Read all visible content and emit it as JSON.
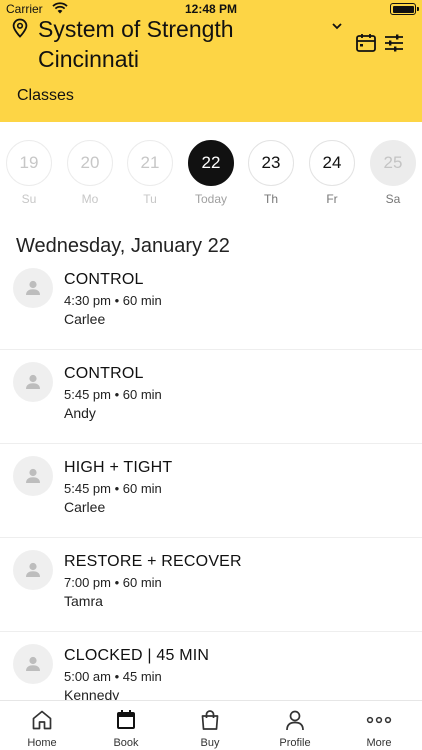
{
  "status_bar": {
    "carrier": "Carrier",
    "time": "12:48 PM"
  },
  "header": {
    "location_line1": "System of Strength",
    "location_line2": "Cincinnati",
    "section_label": "Classes",
    "background_color": "#fdd545"
  },
  "days": [
    {
      "number": "19",
      "label": "Su",
      "state": "past"
    },
    {
      "number": "20",
      "label": "Mo",
      "state": "past"
    },
    {
      "number": "21",
      "label": "Tu",
      "state": "past"
    },
    {
      "number": "22",
      "label": "Today",
      "state": "today"
    },
    {
      "number": "23",
      "label": "Th",
      "state": "future"
    },
    {
      "number": "24",
      "label": "Fr",
      "state": "future"
    },
    {
      "number": "25",
      "label": "Sa",
      "state": "disabled"
    }
  ],
  "date_heading": "Wednesday, January 22",
  "classes": [
    {
      "name": "CONTROL",
      "time": "4:30 pm • 60 min",
      "instructor": "Carlee"
    },
    {
      "name": "CONTROL",
      "time": "5:45 pm • 60 min",
      "instructor": "Andy"
    },
    {
      "name": "HIGH + TIGHT",
      "time": "5:45 pm • 60 min",
      "instructor": "Carlee"
    },
    {
      "name": "RESTORE + RECOVER",
      "time": "7:00 pm • 60 min",
      "instructor": "Tamra"
    },
    {
      "name": "CLOCKED | 45 MIN",
      "time": "5:00 am • 45 min",
      "instructor": "Kennedy"
    }
  ],
  "tabs": [
    {
      "label": "Home",
      "icon": "home-icon"
    },
    {
      "label": "Book",
      "icon": "calendar-icon",
      "active": true
    },
    {
      "label": "Buy",
      "icon": "shopping-bag-icon"
    },
    {
      "label": "Profile",
      "icon": "person-icon"
    },
    {
      "label": "More",
      "icon": "more-dots-icon"
    }
  ]
}
